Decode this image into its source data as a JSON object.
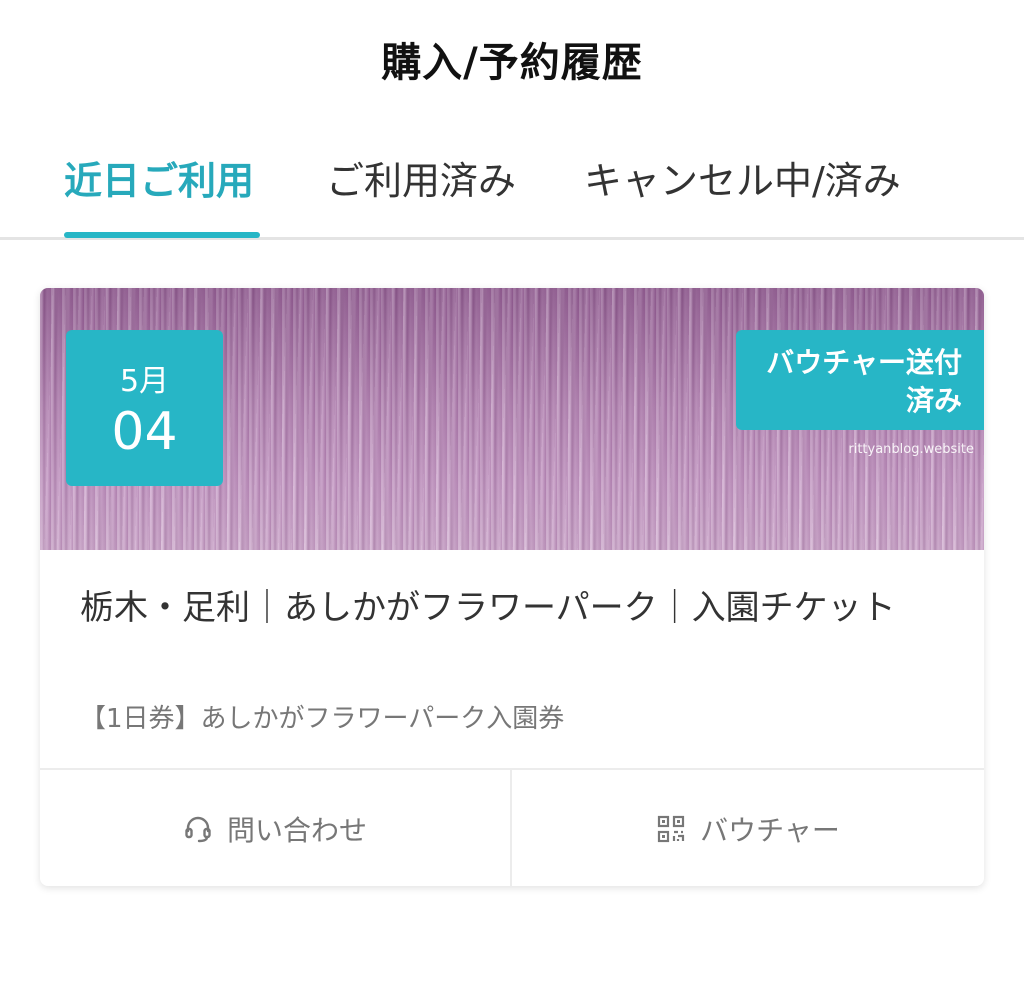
{
  "header": {
    "title": "購入/予約履歴"
  },
  "tabs": [
    {
      "label": "近日ご利用",
      "active": true
    },
    {
      "label": "ご利用済み",
      "active": false
    },
    {
      "label": "キャンセル中/済み",
      "active": false
    }
  ],
  "card": {
    "date": {
      "month": "5月",
      "day": "04"
    },
    "status": {
      "line1": "バウチャー送付",
      "line2": "済み"
    },
    "watermark": "rittyanblog.website",
    "title": "栃木・足利｜あしかがフラワーパーク｜入園チケット",
    "subtitle": "【1日券】あしかがフラワーパーク入園券",
    "actions": {
      "contact_label": "問い合わせ",
      "voucher_label": "バウチャー"
    }
  },
  "colors": {
    "accent": "#27b6c6",
    "accent_text": "#27a9bb"
  },
  "icons": {
    "contact": "headset-icon",
    "voucher": "qr-code-icon"
  }
}
